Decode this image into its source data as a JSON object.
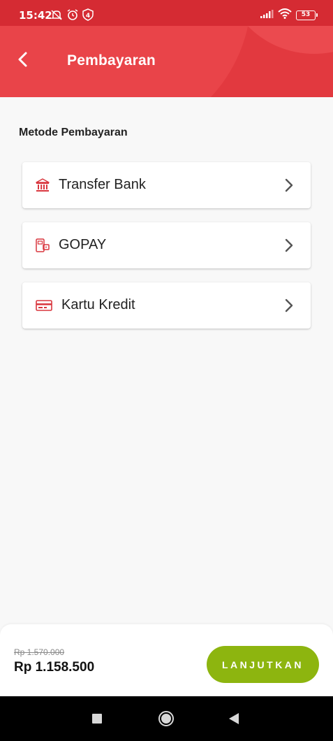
{
  "status_bar": {
    "time": "15:42",
    "battery": "53",
    "icons_left": [
      "notifications-off-icon",
      "alarm-icon",
      "shield-icon"
    ],
    "icons_right": [
      "signal-icon",
      "wifi-icon",
      "battery-icon"
    ]
  },
  "header": {
    "title": "Pembayaran",
    "back_icon": "chevron-left-icon",
    "colors": {
      "header": "#e2393f",
      "status_bar": "#d52b33"
    }
  },
  "section": {
    "title": "Metode Pembayaran"
  },
  "methods": [
    {
      "label": "Transfer Bank",
      "icon": "bank-icon"
    },
    {
      "label": "GOPAY",
      "icon": "wallet-icon"
    },
    {
      "label": "Kartu Kredit",
      "icon": "credit-card-icon"
    }
  ],
  "footer": {
    "old_price": "Rp 1.570.000",
    "new_price": "Rp 1.158.500",
    "continue_label": "LANJUTKAN",
    "colors": {
      "continue_button": "#8db50f"
    }
  },
  "nav_bar": {
    "buttons": [
      "recent-apps-icon",
      "home-icon",
      "back-icon"
    ]
  }
}
